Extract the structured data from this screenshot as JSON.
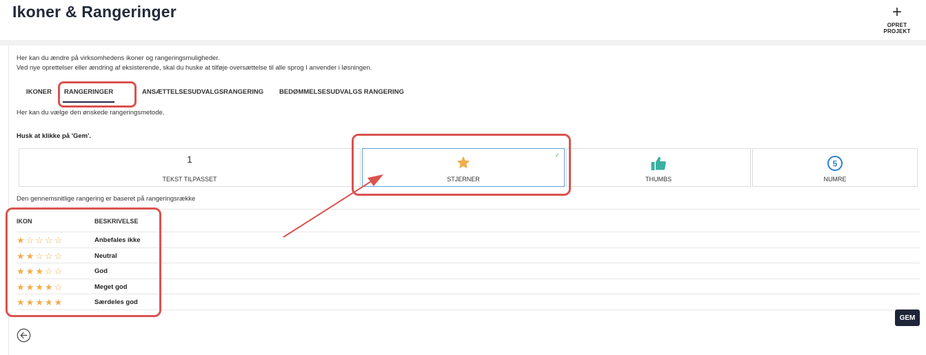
{
  "header": {
    "title": "Ikoner & Rangeringer",
    "new_project_label": "OPRET PROJEKT"
  },
  "intro": {
    "line1": "Her kan du ændre på virksomhedens ikoner og rangeringsmuligheder.",
    "line2": "Ved nye oprettelser eller ændring af eksisterende, skal du huske at tilføje oversættelse til alle sprog I anvender i løsningen."
  },
  "tabs": [
    {
      "label": "IKONER",
      "active": false
    },
    {
      "label": "RANGERINGER",
      "active": true
    },
    {
      "label": "ANSÆTTELSESUDVALGSRANGERING",
      "active": false
    },
    {
      "label": "BEDØMMELSESUDVALGS RANGERING",
      "active": false
    }
  ],
  "tab_description": "Her kan du vælge den ønskede rangeringsmetode.",
  "remember_text": "Husk at klikke på 'Gem'.",
  "options": [
    {
      "big_text": "1",
      "caption": "TEKST TILPASSET",
      "icon": "number-one",
      "selected": false
    },
    {
      "caption": "STJERNER",
      "icon": "star-icon",
      "selected": true
    },
    {
      "caption": "THUMBS",
      "icon": "thumbs-up-icon",
      "selected": false
    },
    {
      "icon_text": "5",
      "caption": "NUMRE",
      "icon": "circled-number-icon",
      "selected": false
    }
  ],
  "average_note": "Den gennemsnitlige rangering er baseret på rangeringsrække",
  "table": {
    "col_icon": "IKON",
    "col_desc": "BESKRIVELSE",
    "rows": [
      {
        "filled_stars": 1,
        "total_stars": 5,
        "description": "Anbefales ikke"
      },
      {
        "filled_stars": 2,
        "total_stars": 5,
        "description": "Neutral"
      },
      {
        "filled_stars": 3,
        "total_stars": 5,
        "description": "God"
      },
      {
        "filled_stars": 4,
        "total_stars": 5,
        "description": "Meget god"
      },
      {
        "filled_stars": 5,
        "total_stars": 5,
        "description": "Særdeles god"
      }
    ]
  },
  "save_label": "GEM",
  "colors": {
    "star": "#f0ad4e",
    "thumbs": "#3cb0a0",
    "numre": "#2b7fd0",
    "selected_border": "#5fa0d8",
    "annotation": "#d9534f",
    "save_bg": "#1f2538"
  }
}
